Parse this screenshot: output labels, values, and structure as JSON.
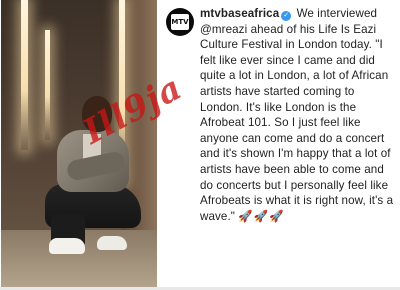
{
  "post": {
    "username": "mtvbaseafrica",
    "verified_glyph": "✓",
    "caption_part1": " We interviewed ",
    "mention": "@mreazi",
    "caption_part2": " ahead of his Life Is Eazi Culture Festival in London today. \"I felt like ever since I came and did quite a lot in London, a lot of African artists have started coming to London. It's like London is the Afrobeat 101. So I just feel like anyone can come and do a concert and it's shown I'm happy that a lot of artists have been able to come and do concerts but I personally feel like Afrobeats is what it is right now, it's a wave.\" ",
    "emojis": "🚀🚀🚀",
    "avatar_text": "MTV",
    "watermark_text": "Ill9ja"
  },
  "colors": {
    "text": "#222222",
    "verified": "#3897f0",
    "watermark": "#c81414"
  },
  "icons": {
    "avatar": "mtv-base-logo-icon",
    "verified": "verified-badge-icon"
  }
}
